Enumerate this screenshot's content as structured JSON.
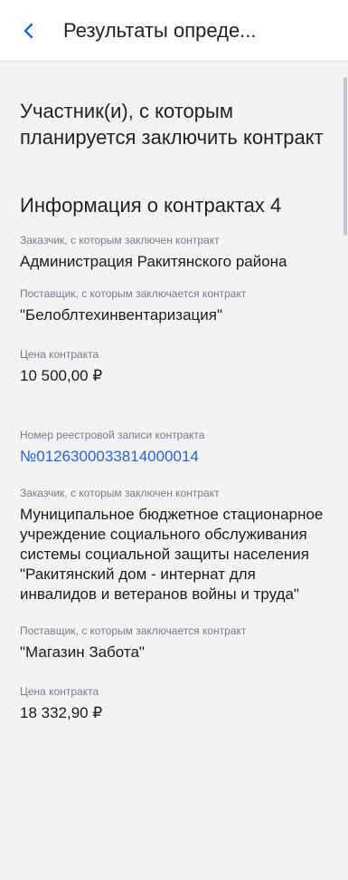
{
  "header": {
    "title": "Результаты опреде..."
  },
  "main": {
    "participant_title": "Участник(и), с которым планируется заключить контракт",
    "contracts_heading": "Информация о контрактах 4",
    "contract1": {
      "customer_label": "Заказчик, с которым заключен контракт",
      "customer_value": "Администрация Ракитянского района",
      "supplier_label": "Поставщик, с которым заключается  контракт",
      "supplier_value": "\"Белоблтехинвентаризация\"",
      "price_label": "Цена контракта",
      "price_value": "10 500,00 ₽"
    },
    "contract2": {
      "registry_label": "Номер реестровой записи контракта",
      "registry_value": "№0126300033814000014",
      "customer_label": "Заказчик, с которым заключен контракт",
      "customer_value": "Муниципальное бюджетное стационарное учреждение социального обслуживания системы социальной защиты населения \"Ракитянский дом - интернат для инвалидов и ветеранов войны и труда\"",
      "supplier_label": "Поставщик, с которым заключается  контракт",
      "supplier_value": "\"Магазин Забота\"",
      "price_label": "Цена контракта",
      "price_value": "18 332,90 ₽"
    }
  },
  "colors": {
    "accent": "#2a62d9",
    "background": "#f2f3f5",
    "label": "#7a7d82"
  }
}
